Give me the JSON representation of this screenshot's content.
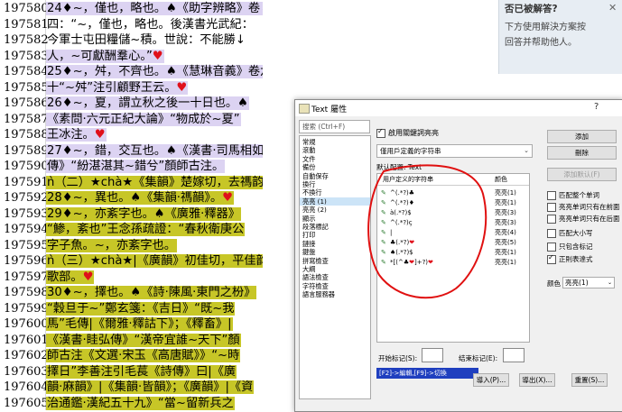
{
  "editor": {
    "line_numbers": [
      "197580",
      "197581",
      "197582",
      "197583",
      "197584",
      "197585",
      "197586",
      "197587",
      "197588",
      "197589",
      "197590",
      "197591",
      "197592",
      "197593",
      "197594",
      "197595",
      "197596",
      "197597",
      "197598",
      "197599",
      "197600",
      "197601",
      "197602",
      "197603",
      "197604",
      "197605"
    ],
    "lines": [
      {
        "text": "24♦~，僅也，略也。♠《助字辨略》卷↓",
        "hl": "purple"
      },
      {
        "text": "四：“~，僅也，略也。後漢書光武紀：",
        "hl": "none"
      },
      {
        "text": "今軍士屯田糧儲~積。世說：不能勝↓",
        "hl": "none"
      },
      {
        "text": "人，~可獻酬羣心。”♥",
        "hl": "purple"
      },
      {
        "text": "25♦~，舛，不齊也。♠《慧琳音義》卷六",
        "hl": "purple"
      },
      {
        "text": "十“~舛”注引顧野王云。♥",
        "hl": "purple"
      },
      {
        "text": "26♦~，夏，謂立秋之後一十日也。♠",
        "hl": "purple"
      },
      {
        "text": "《素問·六元正紀大論》“物成於~夏”",
        "hl": "purple"
      },
      {
        "text": "王冰注。♥",
        "hl": "purple"
      },
      {
        "text": "27♦~，錯，交互也。♠《漢書·司馬相如",
        "hl": "purple"
      },
      {
        "text": "傳》“紛湛湛其~錯兮”顏師古注。",
        "hl": "purple"
      },
      {
        "text": "ǹ（二）★chà★《集韻》楚嫁切，去禡韵。♥",
        "hl": "yellow"
      },
      {
        "text": "28♦~，異也。♠《集韻·禡韻》。♥",
        "hl": "yellow"
      },
      {
        "text": "29♦~，亦紊字也。♠《廣雅·釋器》",
        "hl": "yellow"
      },
      {
        "text": "“鯵，紊也”王念孫疏證：“春秋衛庚公",
        "hl": "yellow"
      },
      {
        "text": "字子魚。~，亦紊字也。",
        "hl": "yellow"
      },
      {
        "text": "ǹ（三）★chà★|《廣韻》初佳切，平佳韵。",
        "hl": "yellow"
      },
      {
        "text": "歌部。♥",
        "hl": "yellow"
      },
      {
        "text": "30♦~，擇也。♠《詩·陳風·東門之枌》",
        "hl": "yellow"
      },
      {
        "text": "“穀旦于~”鄭玄箋：《吉日》“既~我",
        "hl": "yellow"
      },
      {
        "text": "馬”毛傳|《爾雅·釋詁下》；《釋畜》|",
        "hl": "yellow"
      },
      {
        "text": "《漢書·眭弘傳》“漢帝宜誰~天下”顏",
        "hl": "yellow"
      },
      {
        "text": "師古注《文選·宋玉《高唐賦》》“~時",
        "hl": "yellow"
      },
      {
        "text": "擇日”李善注引毛萇《詩傳》曰|《廣",
        "hl": "yellow"
      },
      {
        "text": "韻·麻韻》|《集韻·皆韻》；《廣韻》|《資",
        "hl": "yellow"
      },
      {
        "text": "治通鑑·漢紀五十九》“當~留新兵之",
        "hl": "yellow"
      }
    ]
  },
  "hint_panel": {
    "title": "否已被解答?",
    "close": "✕",
    "body": "下方使用解決方案按\n回答并帮助他人。"
  },
  "dialog": {
    "title": "Text 屬性",
    "help": "?",
    "search_placeholder": "搜索 (Ctrl+F)",
    "categories": [
      "常規",
      "滾動",
      "文件",
      "備份",
      "自動保存",
      "換行",
      "不換行",
      "亮亮 (1)",
      "亮亮 (2)",
      "顯示",
      "段落標記",
      "打印",
      "鏈接",
      "鍵盤",
      "拼寫檢查",
      "大綱",
      "語法檢查",
      "字符檢查",
      "語言服務器"
    ],
    "selected_category": "亮亮 (1)",
    "enable_checkbox": "啟用關鍵詞亮亮",
    "type_dropdown": "僅用戶定義的字符串",
    "config_label": "默认配置: Text",
    "table_headers": {
      "pattern": "用户定义的字符串",
      "color": "颜色"
    },
    "patterns": [
      {
        "pattern": "^(.*?)♣",
        "color": "亮亮(1)"
      },
      {
        "pattern": "^(.*?)♦",
        "color": "亮亮(1)"
      },
      {
        "pattern": "à(.*?)$",
        "color": "亮亮(3)"
      },
      {
        "pattern": "^(.*?)ç",
        "color": "亮亮(3)"
      },
      {
        "pattern": "|",
        "color": "亮亮(4)"
      },
      {
        "pattern": "♣(.*?)❤",
        "color": "亮亮(5)"
      },
      {
        "pattern": "♠(.*?)$",
        "color": "亮亮(1)"
      },
      {
        "pattern": "*[(^♣❤]+?)❤",
        "color": "亮亮(1)"
      }
    ],
    "buttons": {
      "add": "添加",
      "delete": "刪除",
      "add_default": "添加默认(F)",
      "import": "導入(P)...",
      "export": "導出(X)...",
      "reset": "重置(S)..."
    },
    "options": [
      {
        "label": "匹配整个单词",
        "checked": false
      },
      {
        "label": "亮亮单词只有在前面",
        "checked": false
      },
      {
        "label": "亮亮单词只有在后面",
        "checked": false
      },
      {
        "label": "匹配大小写",
        "checked": false
      },
      {
        "label": "只包含标记",
        "checked": false
      },
      {
        "label": "正則表達式",
        "checked": true
      }
    ],
    "color_label": "颜色",
    "color_value": "亮亮(1)",
    "start_label": "开始标记(S):",
    "end_label": "结束标记(E):",
    "status_text": "[F2]->編輯,[F9]->切換"
  },
  "colors": {
    "purple_highlight": "#dcd3f2",
    "yellow_highlight": "#c7c627",
    "annotation": "#e01010",
    "heart": "#e0101a"
  }
}
